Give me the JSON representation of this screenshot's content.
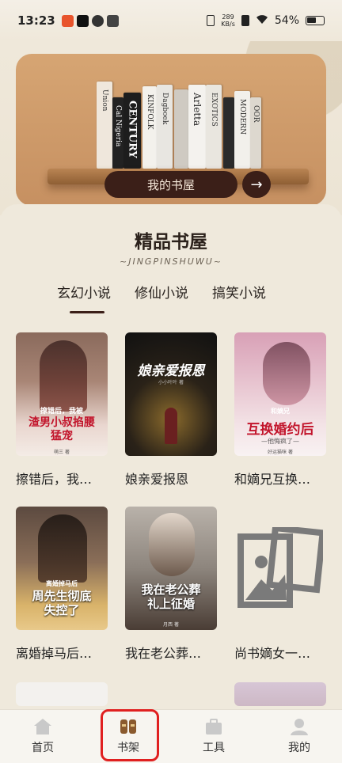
{
  "status_bar": {
    "time": "13:23",
    "net_speed_value": "289",
    "net_speed_unit": "KB/s",
    "battery": "54%"
  },
  "banner": {
    "button_label": "我的书屋",
    "arrow": "→",
    "books": [
      "Union",
      "Cal Nigeria",
      "CENTURY",
      "KINFOLK",
      "Dagboek",
      "Arletta",
      "EXOTICS",
      "MODERN",
      "OOR"
    ]
  },
  "section": {
    "title": "精品书屋",
    "subtitle": "~JINGPINSHUWU~"
  },
  "tabs": [
    {
      "label": "玄幻小说",
      "active": true
    },
    {
      "label": "修仙小说",
      "active": false
    },
    {
      "label": "搞笑小说",
      "active": false
    }
  ],
  "books": [
    {
      "title": "擦错后，我…",
      "cover_text": "渣男小叔掐腰猛宠",
      "cover_subtext": "撩错后，我被",
      "cover_author": "萌三 著"
    },
    {
      "title": "娘亲爱报恩",
      "cover_text": "娘亲爱报恩",
      "cover_author": "小小叶叶 著"
    },
    {
      "title": "和嫡兄互换…",
      "cover_text": "互换婚约后",
      "cover_subtext": "和嫡兄",
      "cover_tagline": "—他悔疯了—",
      "cover_author": "好运猫咪 著"
    },
    {
      "title": "离婚掉马后…",
      "cover_text": "周先生彻底失控了",
      "cover_subtext": "离婚掉马后",
      "cover_author": ""
    },
    {
      "title": "我在老公葬…",
      "cover_text": "我在老公葬礼上征婚",
      "cover_author": "月西 著"
    },
    {
      "title": "尚书嫡女一…",
      "cover_text": "",
      "cover_author": ""
    }
  ],
  "nav": [
    {
      "label": "首页",
      "icon": "home-icon",
      "active": false
    },
    {
      "label": "书架",
      "icon": "bookshelf-icon",
      "active": true
    },
    {
      "label": "工具",
      "icon": "toolbox-icon",
      "active": false
    },
    {
      "label": "我的",
      "icon": "profile-icon",
      "active": false
    }
  ],
  "colors": {
    "accent": "#3b1f18",
    "banner": "#c99464",
    "background": "#efe9dc",
    "highlight": "#e02020"
  }
}
